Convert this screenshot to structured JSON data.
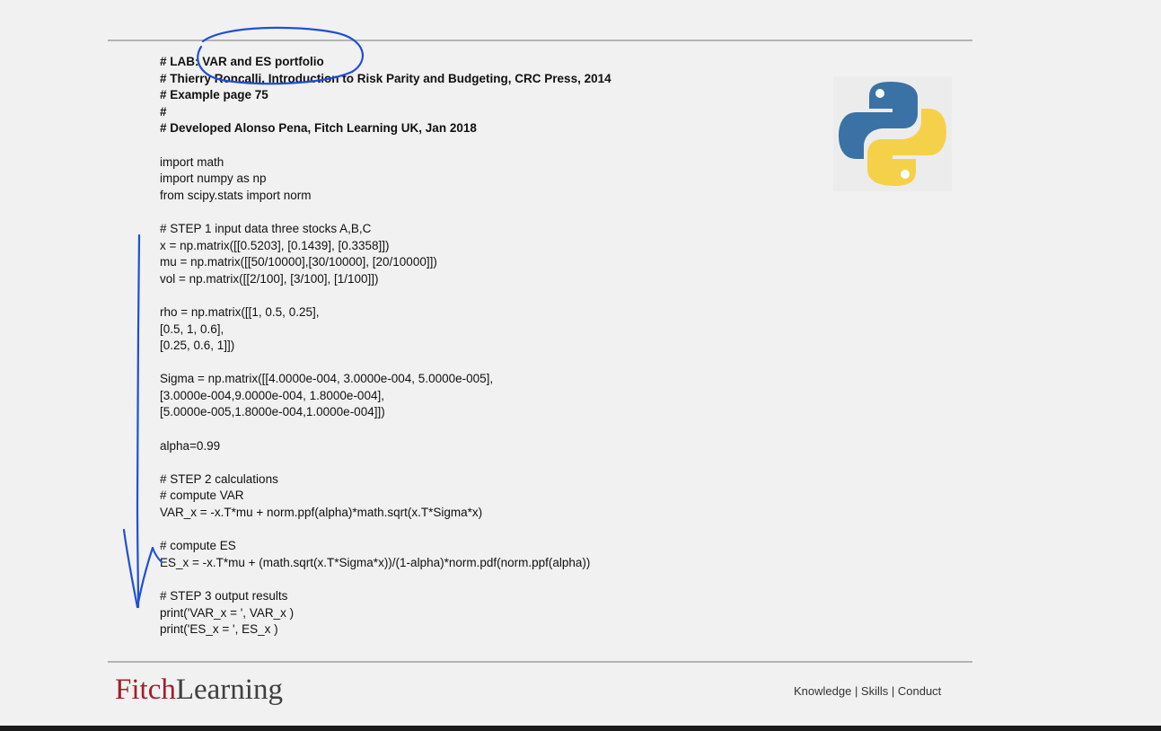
{
  "code_lines": [
    {
      "text": "# LAB: VAR and ES portfolio",
      "bold": true
    },
    {
      "text": "# Thierry Roncalli, Introduction to Risk Parity and Budgeting, CRC Press, 2014",
      "bold": true
    },
    {
      "text": "# Example page 75",
      "bold": true
    },
    {
      "text": "#",
      "bold": true
    },
    {
      "text": "# Developed Alonso Pena, Fitch Learning UK, Jan 2018",
      "bold": true
    },
    {
      "text": "",
      "bold": false
    },
    {
      "text": "import math",
      "bold": false
    },
    {
      "text": "import numpy as np",
      "bold": false
    },
    {
      "text": "from scipy.stats import norm",
      "bold": false
    },
    {
      "text": "",
      "bold": false
    },
    {
      "text": "# STEP 1 input data three stocks A,B,C",
      "bold": false
    },
    {
      "text": "x = np.matrix([[0.5203], [0.1439], [0.3358]])",
      "bold": false
    },
    {
      "text": "mu = np.matrix([[50/10000],[30/10000], [20/10000]])",
      "bold": false
    },
    {
      "text": "vol = np.matrix([[2/100], [3/100], [1/100]])",
      "bold": false
    },
    {
      "text": "",
      "bold": false
    },
    {
      "text": "rho = np.matrix([[1, 0.5, 0.25],",
      "bold": false
    },
    {
      "text": "[0.5, 1, 0.6],",
      "bold": false
    },
    {
      "text": "[0.25, 0.6, 1]])",
      "bold": false
    },
    {
      "text": "",
      "bold": false
    },
    {
      "text": "Sigma = np.matrix([[4.0000e-004, 3.0000e-004, 5.0000e-005],",
      "bold": false
    },
    {
      "text": "[3.0000e-004,9.0000e-004, 1.8000e-004],",
      "bold": false
    },
    {
      "text": "[5.0000e-005,1.8000e-004,1.0000e-004]])",
      "bold": false
    },
    {
      "text": "",
      "bold": false
    },
    {
      "text": "alpha=0.99",
      "bold": false
    },
    {
      "text": "",
      "bold": false
    },
    {
      "text": "# STEP 2 calculations",
      "bold": false
    },
    {
      "text": "# compute VAR",
      "bold": false
    },
    {
      "text": "VAR_x = -x.T*mu + norm.ppf(alpha)*math.sqrt(x.T*Sigma*x)",
      "bold": false
    },
    {
      "text": "",
      "bold": false
    },
    {
      "text": "# compute ES",
      "bold": false
    },
    {
      "text": "ES_x = -x.T*mu + (math.sqrt(x.T*Sigma*x))/(1-alpha)*norm.pdf(norm.ppf(alpha))",
      "bold": false
    },
    {
      "text": "",
      "bold": false
    },
    {
      "text": "# STEP 3 output results",
      "bold": false
    },
    {
      "text": "print('VAR_x = ', VAR_x )",
      "bold": false
    },
    {
      "text": "print('ES_x = ', ES_x )",
      "bold": false
    }
  ],
  "footer": {
    "logo_part1": "Fitch",
    "logo_part2": "Learning",
    "tagline": "Knowledge | Skills | Conduct"
  },
  "colors": {
    "logo_red": "#a01f2a",
    "python_blue": "#3a72a6",
    "python_yellow": "#f5d14a",
    "annotation_ink": "#1f4fd8"
  },
  "icons": {
    "language_logo": "python-logo-icon"
  }
}
